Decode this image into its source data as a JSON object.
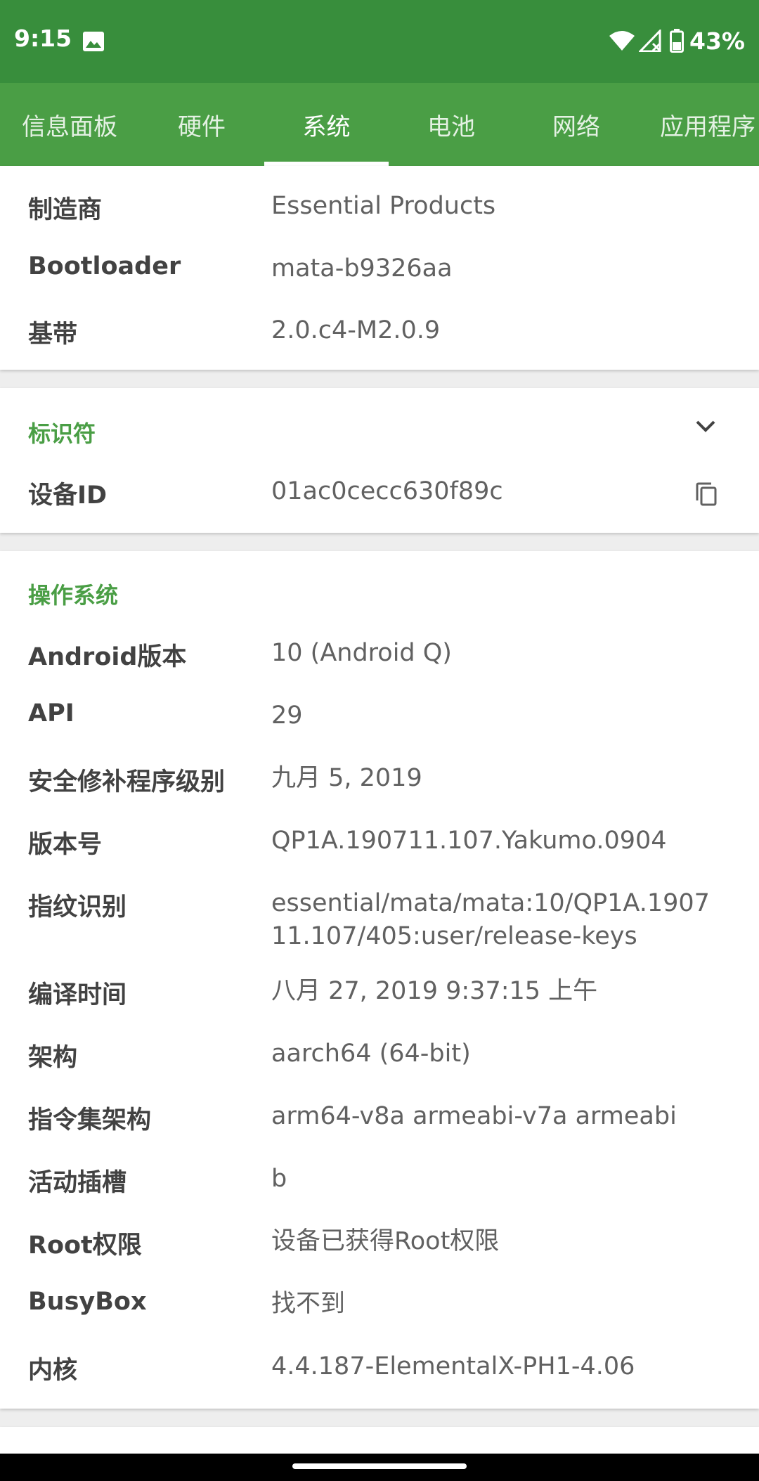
{
  "status_bar": {
    "time": "9:15",
    "battery_percent": "43%",
    "icons": [
      "image-icon",
      "wifi-icon",
      "signal-icon",
      "battery-icon"
    ]
  },
  "tabs": [
    {
      "label": "信息面板",
      "active": false
    },
    {
      "label": "硬件",
      "active": false
    },
    {
      "label": "系统",
      "active": true
    },
    {
      "label": "电池",
      "active": false
    },
    {
      "label": "网络",
      "active": false
    },
    {
      "label": "应用程序",
      "active": false
    }
  ],
  "device_section": {
    "rows": [
      {
        "label": "制造商",
        "value": "Essential Products"
      },
      {
        "label": "Bootloader",
        "value": "mata-b9326aa"
      },
      {
        "label": "基带",
        "value": "2.0.c4-M2.0.9"
      }
    ]
  },
  "identifier_section": {
    "title": "标识符",
    "rows": [
      {
        "label": "设备ID",
        "value": "01ac0cecc630f89c"
      }
    ]
  },
  "os_section": {
    "title": "操作系统",
    "rows": [
      {
        "label": "Android版本",
        "value": "10 (Android Q)"
      },
      {
        "label": "API",
        "value": "29"
      },
      {
        "label": "安全修补程序级别",
        "value": "九月 5, 2019"
      },
      {
        "label": "版本号",
        "value": "QP1A.190711.107.Yakumo.0904"
      },
      {
        "label": "指纹识别",
        "value": "essential/mata/mata:10/QP1A.190711.107/405:user/release-keys"
      },
      {
        "label": "编译时间",
        "value": "八月 27, 2019 9:37:15 上午"
      },
      {
        "label": "架构",
        "value": "aarch64 (64-bit)"
      },
      {
        "label": "指令集架构",
        "value": "arm64-v8a armeabi-v7a armeabi"
      },
      {
        "label": "活动插槽",
        "value": "b"
      },
      {
        "label": "Root权限",
        "value": "设备已获得Root权限"
      },
      {
        "label": "BusyBox",
        "value": "找不到"
      },
      {
        "label": "内核",
        "value": "4.4.187-ElementalX-PH1-4.06"
      }
    ]
  },
  "colors": {
    "status_bar": "#388e3c",
    "tab_bar": "#4a9e45",
    "accent": "#4a9e45",
    "background": "#eeeeee",
    "card": "#ffffff"
  }
}
